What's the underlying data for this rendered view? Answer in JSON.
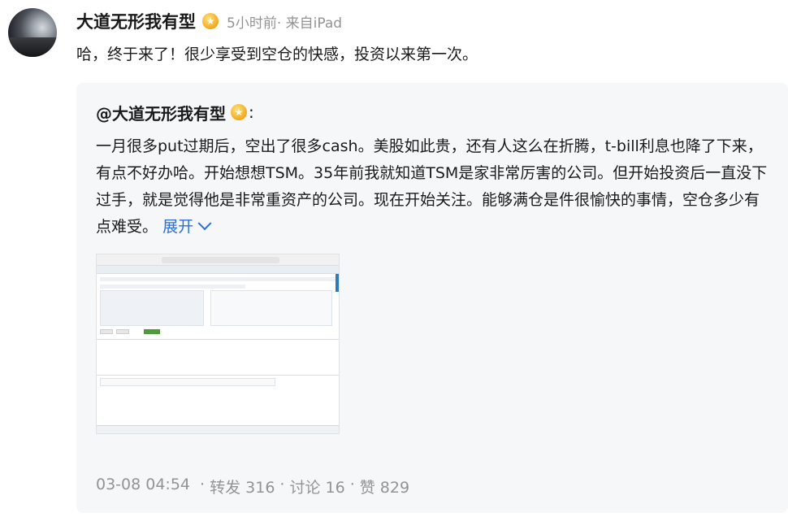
{
  "post": {
    "author": "大道无形我有型",
    "meta": "5小时前· 来自iPad",
    "text": "哈，终于来了！很少享受到空仓的快感，投资以来第一次。"
  },
  "repost": {
    "author": "@大道无形我有型",
    "colon": ":",
    "text": "一月很多put过期后，空出了很多cash。美股如此贵，还有人这么在折腾，t-bill利息也降了下来，有点不好办哈。开始想想TSM。35年前我就知道TSM是家非常厉害的公司。但开始投资后一直没下过手，就是觉得他是非常重资产的公司。现在开始关注。能够满仓是件很愉快的事情，空仓多少有点难受。",
    "expand_label": "展开"
  },
  "footer": {
    "date": "03-08 04:54",
    "repost_label": "转发 316",
    "comment_label": "讨论 16",
    "like_label": "赞 829"
  },
  "icons": {
    "vip": "vip-badge-icon",
    "expand": "chevron-down-icon"
  },
  "colors": {
    "link": "#2a6fdb",
    "meta": "#939393",
    "repost_bg": "#f6f7f9"
  }
}
